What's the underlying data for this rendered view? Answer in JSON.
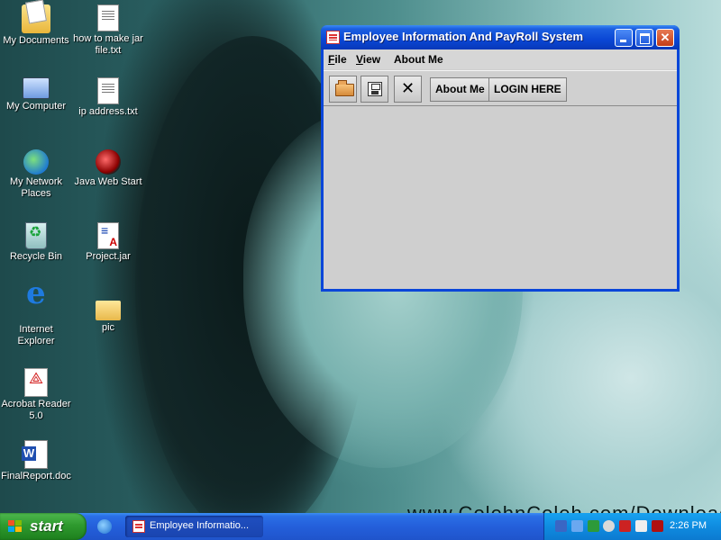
{
  "desktop": {
    "watermark": "www.ColehnColeh.com/Download",
    "icons": [
      {
        "label": "My Documents"
      },
      {
        "label": "how to make jar file.txt"
      },
      {
        "label": "My Computer"
      },
      {
        "label": "ip address.txt"
      },
      {
        "label": "My Network Places"
      },
      {
        "label": "Java Web Start"
      },
      {
        "label": "Recycle Bin"
      },
      {
        "label": "Project.jar"
      },
      {
        "label": "Internet Explorer"
      },
      {
        "label": "pic"
      },
      {
        "label": "Acrobat Reader 5.0"
      },
      {
        "label": "FinalReport.doc"
      }
    ]
  },
  "window": {
    "title": "Employee Information And PayRoll System",
    "menu": {
      "file": {
        "label_underlined": "F",
        "label_rest": "ile"
      },
      "view": {
        "label_underlined": "V",
        "label_rest": "iew"
      },
      "about": {
        "label": "About Me"
      }
    },
    "toolbar": {
      "open_icon": "open-folder-icon",
      "save_icon": "floppy-disk-icon",
      "close_glyph": "✕",
      "about_label": "About Me",
      "login_label": "LOGIN HERE"
    }
  },
  "taskbar": {
    "start_label": "start",
    "task_label": "Employee Informatio...",
    "clock": "2:26 PM"
  },
  "colors": {
    "title_bar": "#0a47d5",
    "client_bg": "#cfcfcf",
    "start_green": "#2e9a2e",
    "taskbar_blue": "#245fdb"
  }
}
